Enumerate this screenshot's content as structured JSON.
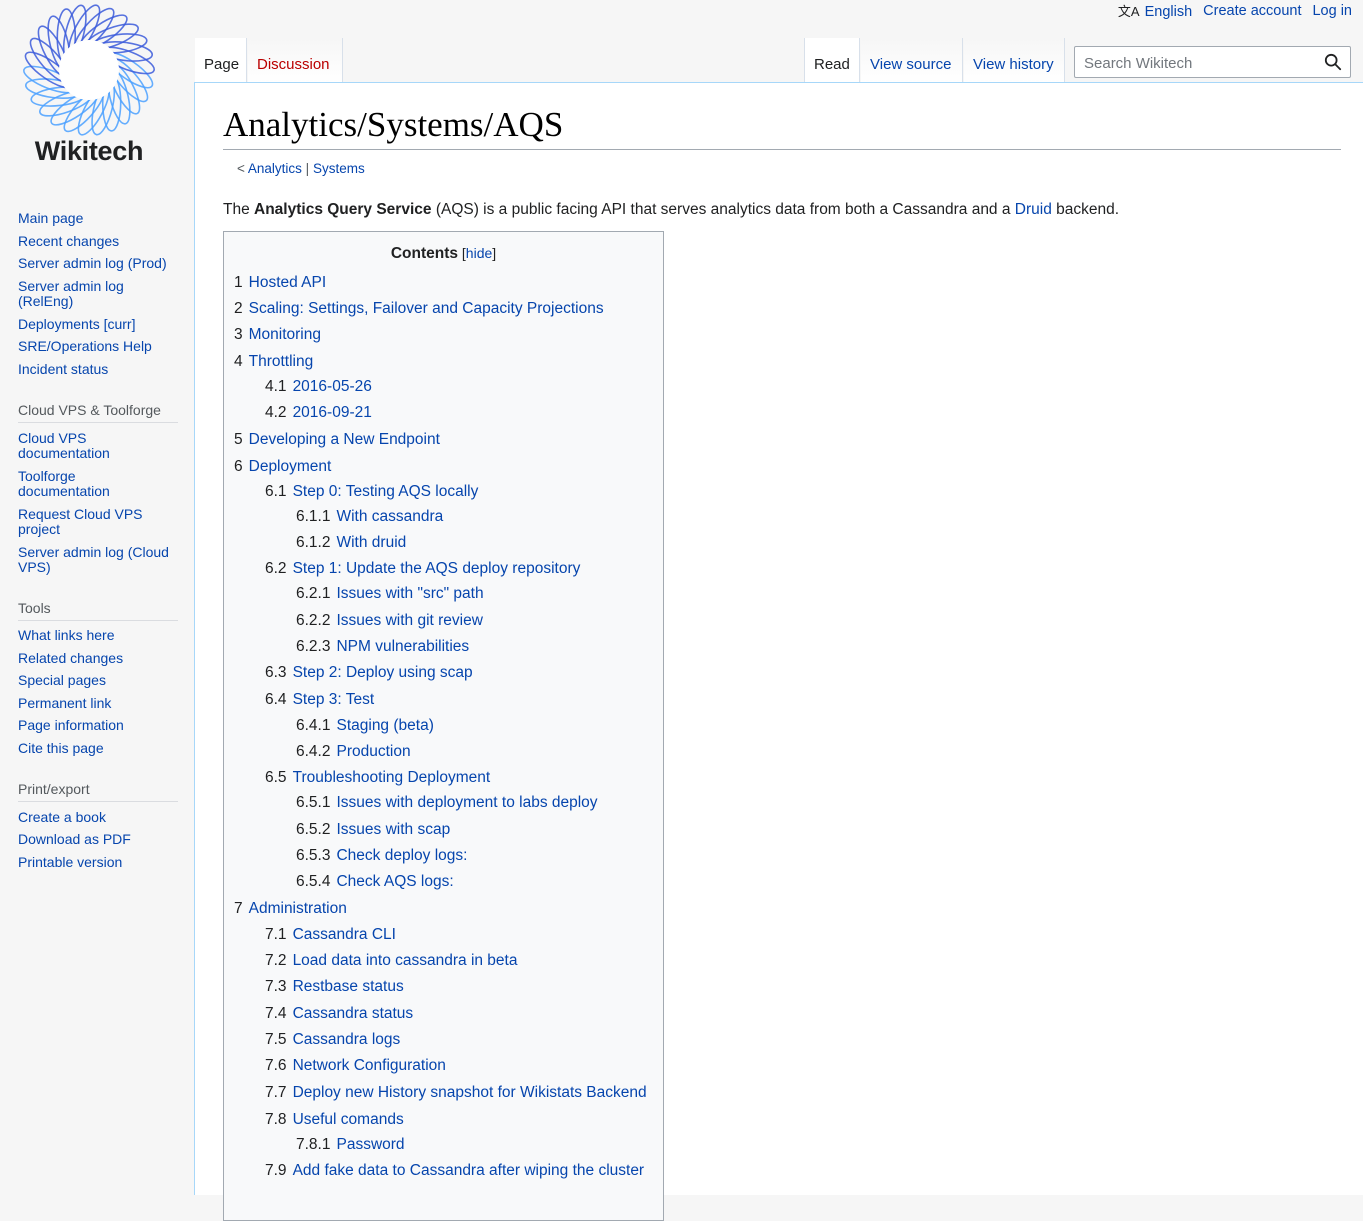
{
  "site": {
    "name": "Wikitech"
  },
  "personal_tools": {
    "language": "English",
    "create_account": "Create account",
    "log_in": "Log in"
  },
  "tabs": {
    "page": "Page",
    "discussion": "Discussion",
    "read": "Read",
    "view_source": "View source",
    "view_history": "View history"
  },
  "search": {
    "placeholder": "Search Wikitech"
  },
  "page": {
    "title": "Analytics/Systems/AQS",
    "subpages_prefix": "< ",
    "subpage_1": "Analytics",
    "subpage_sep": " | ",
    "subpage_2": "Systems",
    "intro": {
      "t1": "The ",
      "bold": "Analytics Query Service",
      "t2": " (AQS) is a public facing API that serves analytics data from both a Cassandra and a ",
      "link": "Druid",
      "t3": " backend."
    }
  },
  "toc": {
    "heading": "Contents",
    "hide_open": " [",
    "hide": "hide",
    "hide_close": "]",
    "items": [
      {
        "num": "1",
        "text": "Hosted API",
        "level": 1
      },
      {
        "num": "2",
        "text": "Scaling: Settings, Failover and Capacity Projections",
        "level": 1
      },
      {
        "num": "3",
        "text": "Monitoring",
        "level": 1
      },
      {
        "num": "4",
        "text": "Throttling",
        "level": 1
      },
      {
        "num": "4.1",
        "text": "2016-05-26",
        "level": 2
      },
      {
        "num": "4.2",
        "text": "2016-09-21",
        "level": 2
      },
      {
        "num": "5",
        "text": "Developing a New Endpoint",
        "level": 1
      },
      {
        "num": "6",
        "text": "Deployment",
        "level": 1
      },
      {
        "num": "6.1",
        "text": "Step 0: Testing AQS locally",
        "level": 2
      },
      {
        "num": "6.1.1",
        "text": "With cassandra",
        "level": 3
      },
      {
        "num": "6.1.2",
        "text": "With druid",
        "level": 3
      },
      {
        "num": "6.2",
        "text": "Step 1: Update the AQS deploy repository",
        "level": 2
      },
      {
        "num": "6.2.1",
        "text": "Issues with \"src\" path",
        "level": 3
      },
      {
        "num": "6.2.2",
        "text": "Issues with git review",
        "level": 3
      },
      {
        "num": "6.2.3",
        "text": "NPM vulnerabilities",
        "level": 3
      },
      {
        "num": "6.3",
        "text": "Step 2: Deploy using scap",
        "level": 2
      },
      {
        "num": "6.4",
        "text": "Step 3: Test",
        "level": 2
      },
      {
        "num": "6.4.1",
        "text": "Staging (beta)",
        "level": 3
      },
      {
        "num": "6.4.2",
        "text": "Production",
        "level": 3
      },
      {
        "num": "6.5",
        "text": "Troubleshooting Deployment",
        "level": 2
      },
      {
        "num": "6.5.1",
        "text": "Issues with deployment to labs deploy",
        "level": 3
      },
      {
        "num": "6.5.2",
        "text": "Issues with scap",
        "level": 3
      },
      {
        "num": "6.5.3",
        "text": "Check deploy logs:",
        "level": 3
      },
      {
        "num": "6.5.4",
        "text": "Check AQS logs:",
        "level": 3
      },
      {
        "num": "7",
        "text": "Administration",
        "level": 1
      },
      {
        "num": "7.1",
        "text": "Cassandra CLI",
        "level": 2
      },
      {
        "num": "7.2",
        "text": "Load data into cassandra in beta",
        "level": 2
      },
      {
        "num": "7.3",
        "text": "Restbase status",
        "level": 2
      },
      {
        "num": "7.4",
        "text": "Cassandra status",
        "level": 2
      },
      {
        "num": "7.5",
        "text": "Cassandra logs",
        "level": 2
      },
      {
        "num": "7.6",
        "text": "Network Configuration",
        "level": 2
      },
      {
        "num": "7.7",
        "text": "Deploy new History snapshot for Wikistats Backend",
        "level": 2
      },
      {
        "num": "7.8",
        "text": "Useful comands",
        "level": 2
      },
      {
        "num": "7.8.1",
        "text": "Password",
        "level": 3
      },
      {
        "num": "7.9",
        "text": "Add fake data to Cassandra after wiping the cluster",
        "level": 2
      }
    ]
  },
  "sidebar": {
    "navigation": [
      "Main page",
      "Recent changes",
      "Server admin log (Prod)",
      "Server admin log (RelEng)",
      "Deployments [curr]",
      "SRE/Operations Help",
      "Incident status"
    ],
    "cloud_heading": "Cloud VPS & Toolforge",
    "cloud": [
      "Cloud VPS documentation",
      "Toolforge documentation",
      "Request Cloud VPS project",
      "Server admin log (Cloud VPS)"
    ],
    "tools_heading": "Tools",
    "tools": [
      "What links here",
      "Related changes",
      "Special pages",
      "Permanent link",
      "Page information",
      "Cite this page"
    ],
    "print_heading": "Print/export",
    "print": [
      "Create a book",
      "Download as PDF",
      "Printable version"
    ]
  },
  "colors": {
    "link": "#0645ad",
    "new_link": "#ba0000",
    "logo_blue": "#3366cc",
    "content_border": "#a7d7f9"
  },
  "icons": {
    "logo": "wikitech-flower-logo",
    "language": "language-icon",
    "search": "search-icon"
  }
}
